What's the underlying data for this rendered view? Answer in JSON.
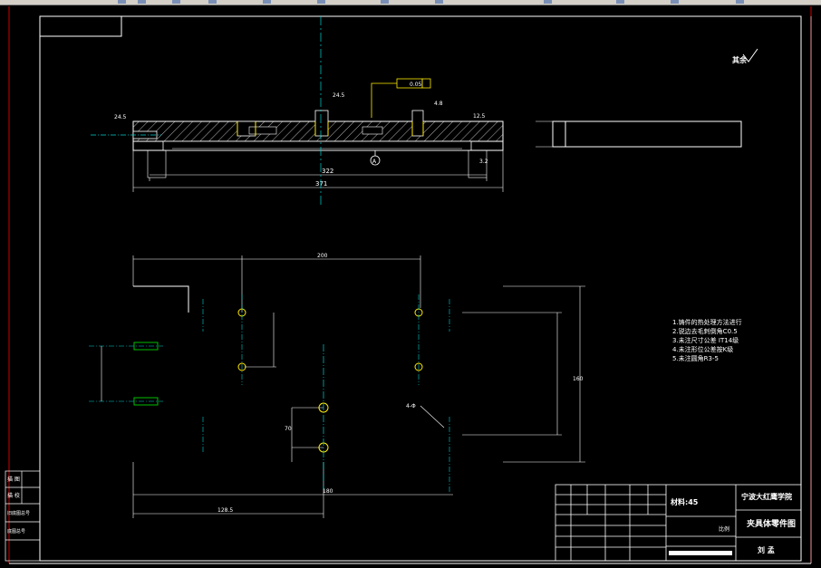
{
  "title_block": {
    "school": "宁波大红鹰学院",
    "drawing_name": "夹具体零件图",
    "material": "材料:45",
    "scale_label": "比例",
    "author": "刘 孟"
  },
  "notes": {
    "line1": "1.铸件的热处理方法进行",
    "line2": "2.锐边去毛刺倒角C0.5",
    "line3": "3.未注尺寸公差 IT14级",
    "line4": "4.未注形位公差按K级",
    "line5": "5.未注圆角R3-5"
  },
  "section_view": {
    "flatness_tol": "0.05",
    "datum": "A",
    "dim_inner": "322",
    "dim_total": "371",
    "roughness_top": "12.5",
    "roughness_side": "3.2"
  },
  "plan_view": {
    "dim_top": "200",
    "dim_right": "160",
    "dim_bottom": "180",
    "dim_bottom_total": "128.5",
    "hole_spec": "4-Φ",
    "dim_small": "70"
  },
  "roughness_corner": "其余",
  "left_strip": {
    "row1": "描 图",
    "row2": "描 校",
    "row3": "旧底图总号",
    "row4": "底图总号"
  }
}
